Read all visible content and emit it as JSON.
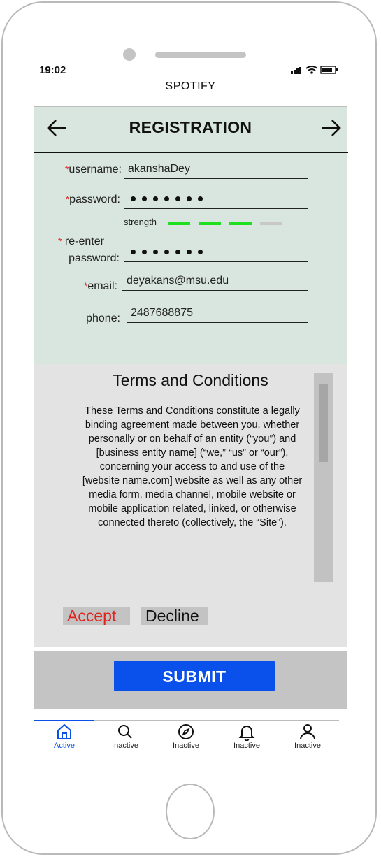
{
  "status_bar": {
    "time": "19:02"
  },
  "app": {
    "title": "SPOTIFY"
  },
  "header": {
    "title": "REGISTRATION",
    "back_icon": "arrow-left-icon",
    "forward_icon": "arrow-right-icon"
  },
  "form": {
    "required_marker": "*",
    "username": {
      "label": "username:",
      "value": "akanshaDey",
      "required": true
    },
    "password": {
      "label": "password:",
      "masked_length": 7,
      "required": true
    },
    "strength": {
      "label": "strength",
      "level": 3,
      "max": 4,
      "active_color": "#1fe01f",
      "inactive_color": "#c8c8c8"
    },
    "reenter": {
      "label_line1": "re-enter",
      "label_line2": "password:",
      "masked_length": 7,
      "required": true
    },
    "email": {
      "label": "email:",
      "value": "deyakans@msu.edu",
      "required": true
    },
    "phone": {
      "label": "phone:",
      "value": "2487688875",
      "required": false
    }
  },
  "terms": {
    "title": "Terms and Conditions",
    "body": "These Terms and Conditions constitute a legally binding agreement made between you, whether personally or on behalf of an entity (“you”) and [business entity name] (“we,” “us” or “our”), concerning your access to and use of the [website name.com] website as well as any other media form, media channel, mobile website or mobile application related, linked, or otherwise connected thereto (collectively, the “Site”).",
    "accept_label": "Accept",
    "decline_label": "Decline"
  },
  "submit": {
    "label": "SUBMIT",
    "color": "#0a51eb"
  },
  "tabbar": {
    "items": [
      {
        "label": "Active",
        "icon": "home-icon",
        "active": true
      },
      {
        "label": "Inactive",
        "icon": "search-icon",
        "active": false
      },
      {
        "label": "Inactive",
        "icon": "compass-icon",
        "active": false
      },
      {
        "label": "Inactive",
        "icon": "bell-icon",
        "active": false
      },
      {
        "label": "Inactive",
        "icon": "user-icon",
        "active": false
      }
    ]
  }
}
